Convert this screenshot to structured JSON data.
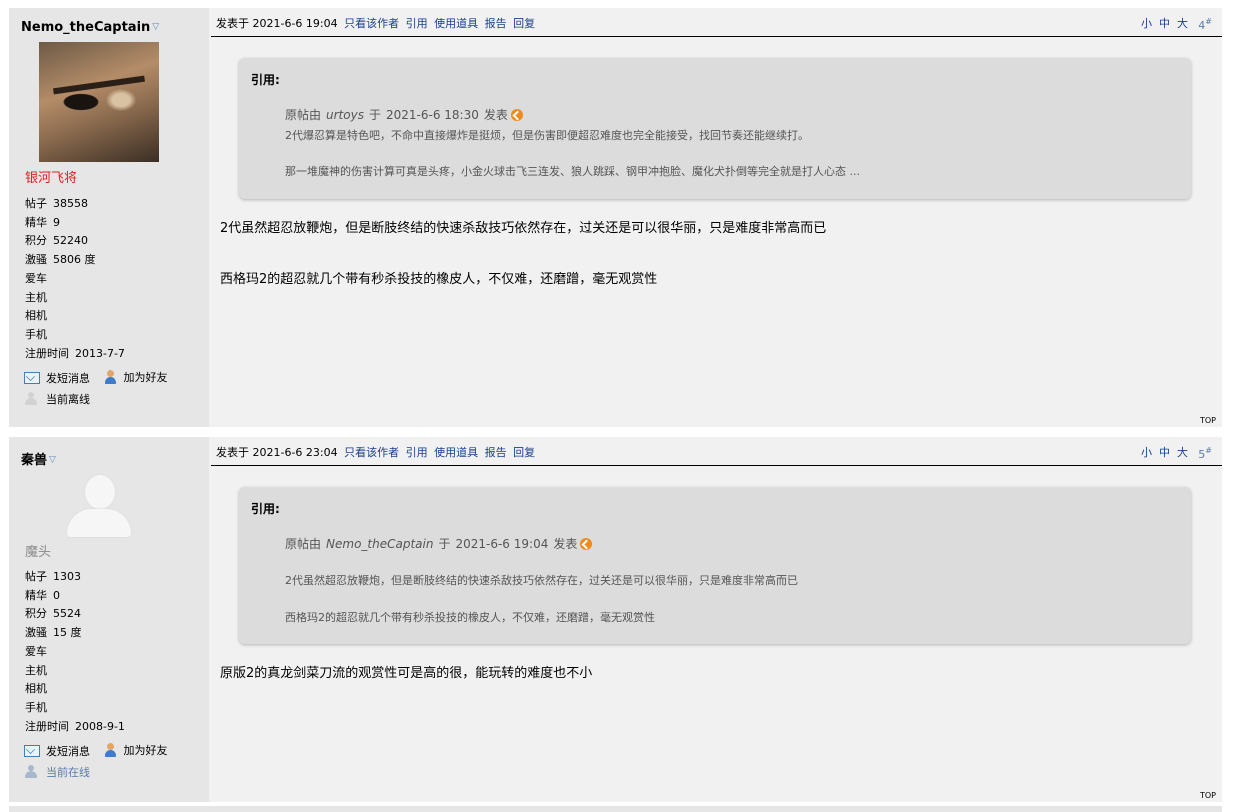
{
  "common": {
    "send_message": "发短消息",
    "add_friend": "加为好友",
    "only_author": "只看该作者",
    "quote": "引用",
    "use_item": "使用道具",
    "report": "报告",
    "reply": "回复",
    "size_small": "小",
    "size_medium": "中",
    "size_large": "大",
    "floor_suffix": "#",
    "quote_header": "引用:",
    "quote_by_prefix": "原帖由",
    "quote_by_mid": "于",
    "quote_by_suffix": "发表",
    "top": "TOP"
  },
  "posts": [
    {
      "author": "Nemo_theCaptain",
      "rank": "银河飞将",
      "rank_color": "#e02020",
      "stats": [
        {
          "label": "帖子",
          "value": "38558"
        },
        {
          "label": "精华",
          "value": "9"
        },
        {
          "label": "积分",
          "value": "52240"
        },
        {
          "label": "激骚",
          "value": "5806 度"
        },
        {
          "label": "爱车",
          "value": ""
        },
        {
          "label": "主机",
          "value": ""
        },
        {
          "label": "相机",
          "value": ""
        },
        {
          "label": "手机",
          "value": ""
        },
        {
          "label": "注册时间",
          "value": "2013-7-7"
        }
      ],
      "status": "当前离线",
      "posted": "发表于 2021-6-6 19:04",
      "floor": "4",
      "quote": {
        "author": "urtoys",
        "time": "2021-6-6 18:30",
        "line1": "2代爆忍算是特色吧，不命中直接爆炸是挺烦，但是伤害即便超忍难度也完全能接受，找回节奏还能继续打。",
        "line2": "那一堆魔神的伤害计算可真是头疼，小金火球击飞三连发、狼人跳踩、钢甲冲抱脸、魔化犬扑倒等完全就是打人心态 ..."
      },
      "body1": "2代虽然超忍放鞭炮，但是断肢终结的快速杀敌技巧依然存在，过关还是可以很华丽，只是难度非常高而已",
      "body2": "西格玛2的超忍就几个带有秒杀投技的橡皮人，不仅难，还磨蹭，毫无观赏性"
    },
    {
      "author": "秦兽",
      "rank": "魔头",
      "rank_color": "#8a8a8a",
      "stats": [
        {
          "label": "帖子",
          "value": "1303"
        },
        {
          "label": "精华",
          "value": "0"
        },
        {
          "label": "积分",
          "value": "5524"
        },
        {
          "label": "激骚",
          "value": "15 度"
        },
        {
          "label": "爱车",
          "value": ""
        },
        {
          "label": "主机",
          "value": ""
        },
        {
          "label": "相机",
          "value": ""
        },
        {
          "label": "手机",
          "value": ""
        },
        {
          "label": "注册时间",
          "value": "2008-9-1"
        }
      ],
      "status": "当前在线",
      "posted": "发表于 2021-6-6 23:04",
      "floor": "5",
      "quote": {
        "author": "Nemo_theCaptain",
        "time": "2021-6-6 19:04",
        "line1": "2代虽然超忍放鞭炮，但是断肢终结的快速杀敌技巧依然存在，过关还是可以很华丽，只是难度非常高而已",
        "line2": "西格玛2的超忍就几个带有秒杀投技的橡皮人，不仅难，还磨蹭，毫无观赏性"
      },
      "body1": "原版2的真龙剑菜刀流的观赏性可是高的很，能玩转的难度也不小"
    }
  ]
}
